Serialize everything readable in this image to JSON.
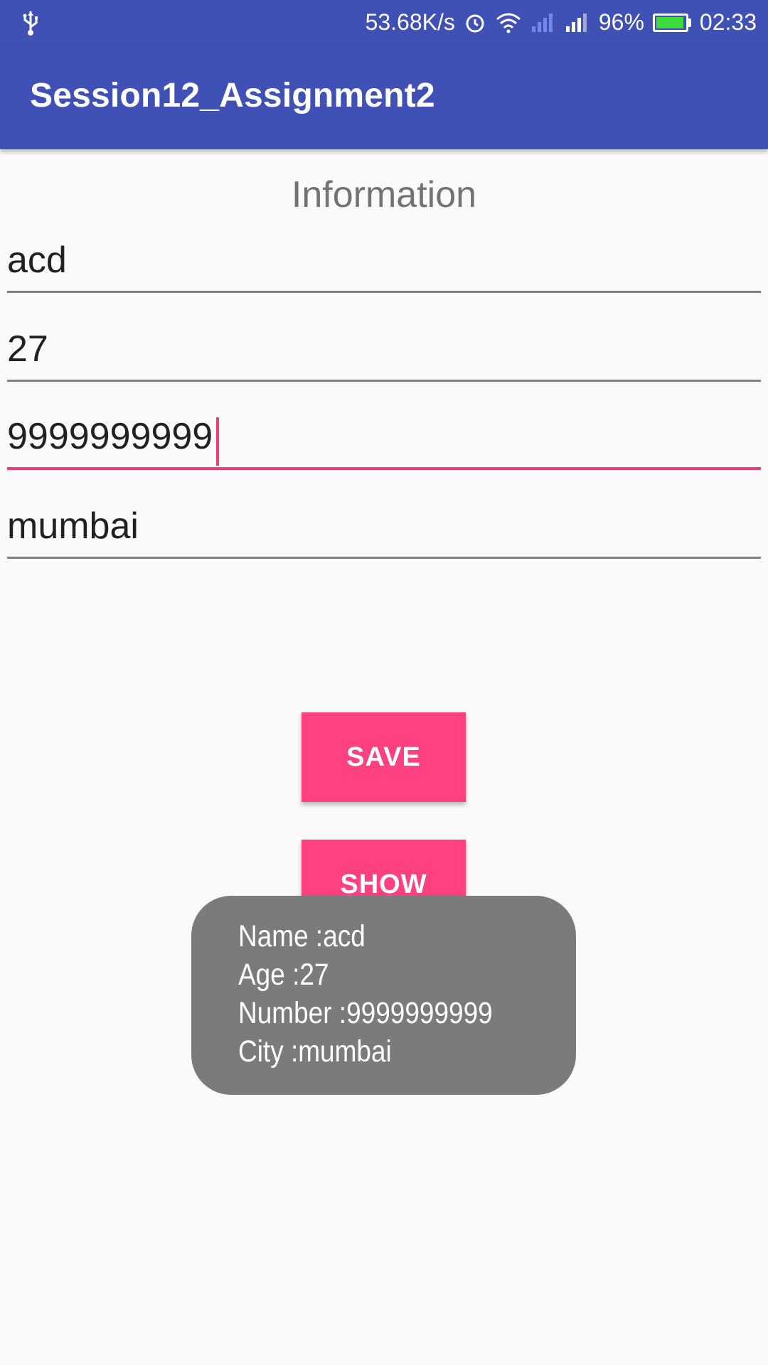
{
  "status_bar": {
    "network_speed": "53.68K/s",
    "battery_percent": "96%",
    "battery_level": 0.96,
    "time": "02:33",
    "icons": [
      "usb-icon",
      "alarm-icon",
      "wifi-icon",
      "signal-off-icon",
      "signal-icon",
      "battery-icon"
    ]
  },
  "app_bar": {
    "title": "Session12_Assignment2"
  },
  "form": {
    "heading": "Information",
    "name_value": "acd",
    "age_value": "27",
    "number_value": "9999999999",
    "city_value": "mumbai"
  },
  "buttons": {
    "save_label": "SAVE",
    "show_label": "SHOW"
  },
  "toast": {
    "lines": [
      "Name :acd",
      "Age :27",
      "Number :9999999999",
      "City :mumbai"
    ]
  },
  "colors": {
    "primary": "#3f51b5",
    "accent": "#ff4081",
    "focus_underline": "#ec407a",
    "toast_bg": "#7b7b7b"
  }
}
